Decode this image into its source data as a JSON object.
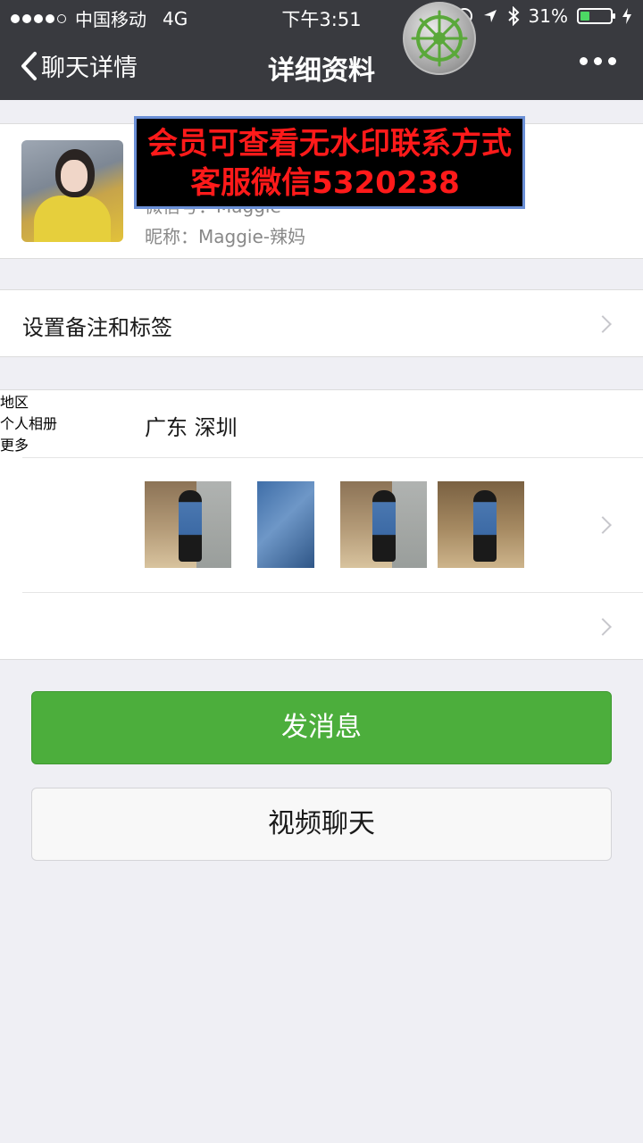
{
  "status_bar": {
    "carrier": "中国移动",
    "network": "4G",
    "time": "下午3:51",
    "battery": "31%",
    "battery_level": 0.31
  },
  "nav": {
    "back_label": "聊天详情",
    "title": "详细资料"
  },
  "profile": {
    "wechat_id_partial": "微信号：Maggie-",
    "nickname": "昵称：Maggie-辣妈"
  },
  "watermark": {
    "line1": "会员可查看无水印联系方式",
    "line2": "客服微信5320238",
    "text_color": "#ff1a1a"
  },
  "rows": {
    "remark": "设置备注和标签",
    "region_label": "地区",
    "region_value": "广东 深圳",
    "album": "个人相册",
    "more": "更多"
  },
  "buttons": {
    "send_message": "发消息",
    "video_call": "视频聊天"
  },
  "colors": {
    "nav_bg": "#393a3f",
    "accent_green": "#4cae3c",
    "page_bg": "#efeff4"
  }
}
